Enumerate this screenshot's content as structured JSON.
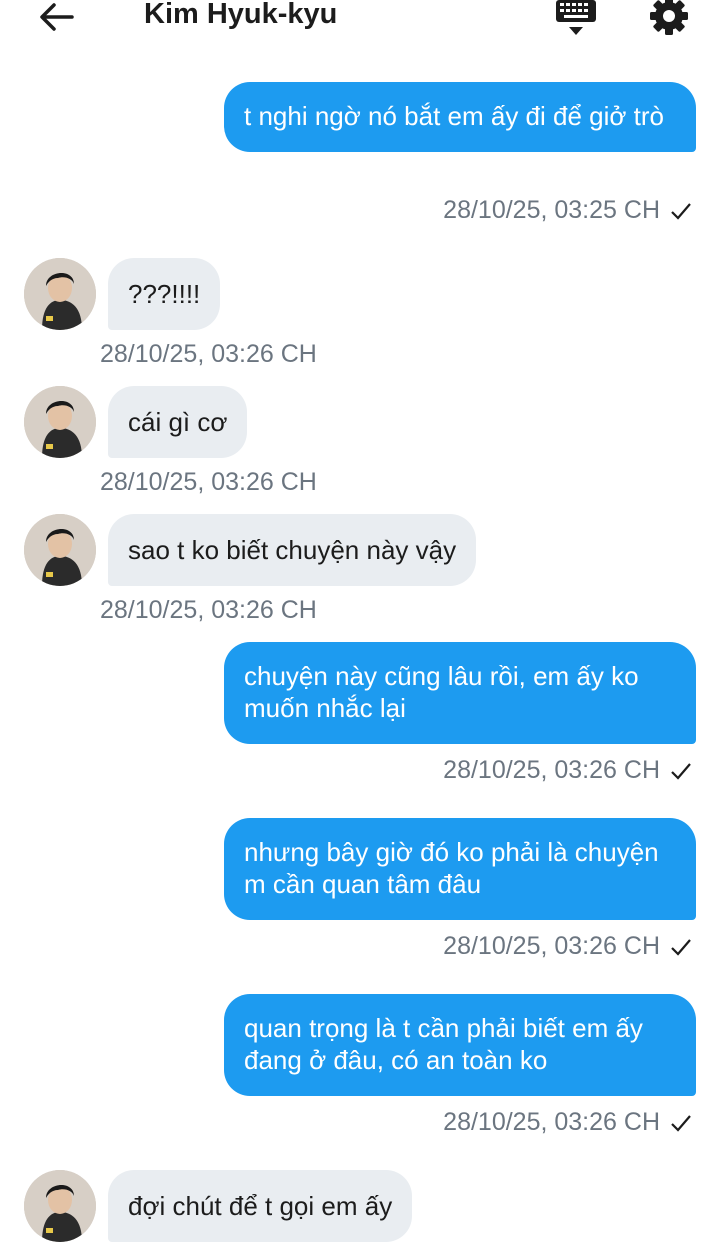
{
  "header": {
    "title": "Kim Hyuk-kyu",
    "back_icon": "back-arrow-icon",
    "keyboard_icon": "keyboard-icon",
    "settings_icon": "gear-icon"
  },
  "colors": {
    "outgoing_bubble": "#1d9bf0",
    "incoming_bubble": "#e9edf1",
    "timestamp": "#6b7580"
  },
  "messages": [
    {
      "direction": "out",
      "text": "t nghi ngờ nó bắt em ấy đi để giở trò",
      "time": "28/10/25, 03:25 CH",
      "status": "sent"
    },
    {
      "direction": "in",
      "text": "???!!!!",
      "time": "28/10/25, 03:26 CH"
    },
    {
      "direction": "in",
      "text": "cái gì cơ",
      "time": "28/10/25, 03:26 CH"
    },
    {
      "direction": "in",
      "text": "sao t ko biết chuyện này vậy",
      "time": "28/10/25, 03:26 CH"
    },
    {
      "direction": "out",
      "text": "chuyện này cũng lâu rồi, em ấy ko muốn nhắc lại",
      "time": "28/10/25, 03:26 CH",
      "status": "sent"
    },
    {
      "direction": "out",
      "text": "nhưng bây giờ đó ko phải là chuyện m cần quan tâm đâu",
      "time": "28/10/25, 03:26 CH",
      "status": "sent"
    },
    {
      "direction": "out",
      "text": "quan trọng là t cần phải biết em ấy đang ở đâu, có an toàn ko",
      "time": "28/10/25, 03:26 CH",
      "status": "sent"
    },
    {
      "direction": "in",
      "text": "đợi chút để t gọi em ấy"
    }
  ]
}
